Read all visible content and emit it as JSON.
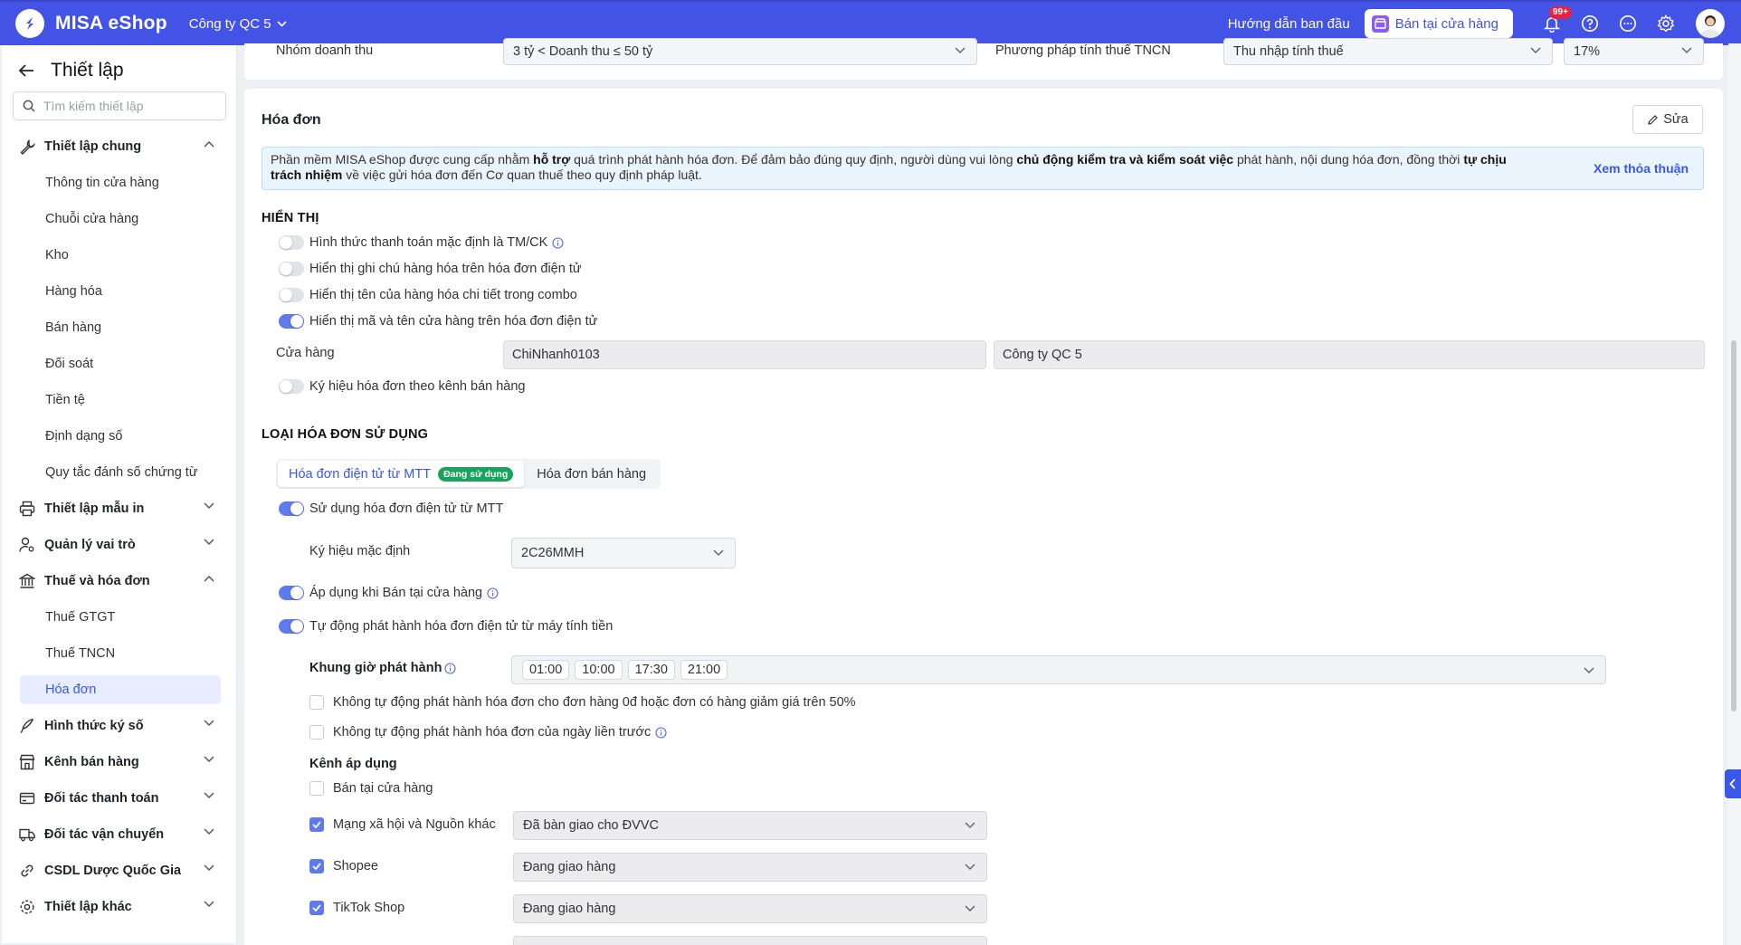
{
  "topbar": {
    "brand": "MISA eShop",
    "company": "Công ty QC 5",
    "guide": "Hướng dẫn ban đầu",
    "store_button": "Bán tại cửa hàng",
    "notification_count": "99+",
    "colors": {
      "bar": "#4353e6",
      "badge": "#e5213d"
    }
  },
  "sidebar": {
    "title": "Thiết lập",
    "search_placeholder": "Tìm kiếm thiết lập",
    "general": "Thiết lập chung",
    "general_items": [
      "Thông tin cửa hàng",
      "Chuỗi cửa hàng",
      "Kho",
      "Hàng hóa",
      "Bán hàng",
      "Đối soát",
      "Tiền tệ",
      "Định dạng số",
      "Quy tắc đánh số chứng từ"
    ],
    "print_template": "Thiết lập mẫu in",
    "roles": "Quản lý vai trò",
    "tax_invoice": "Thuế và hóa đơn",
    "tax_items": [
      "Thuế GTGT",
      "Thuế TNCN",
      "Hóa đơn"
    ],
    "signature": "Hình thức ký số",
    "sales_channels": "Kênh bán hàng",
    "payment_partners": "Đối tác thanh toán",
    "shipping_partners": "Đối tác vận chuyển",
    "pharma_db": "CSDL Dược Quốc Gia",
    "other": "Thiết lập khác"
  },
  "tax_row": {
    "revenue_group_label": "Nhóm doanh thu",
    "revenue_group_value": "3 tỷ < Doanh thu ≤ 50 tỷ",
    "pit_method_label": "Phương pháp tính thuế TNCN",
    "pit_method_value": "Thu nhập tính thuế",
    "rate_value": "17%"
  },
  "invoice": {
    "title": "Hóa đơn",
    "edit": "Sửa",
    "notice_1": "Phần mềm MISA eShop được cung cấp nhằm ",
    "notice_b1": "hỗ trợ",
    "notice_2": " quá trình phát hành hóa đơn. Để đảm bảo đúng quy định, người dùng vui lòng ",
    "notice_b2": "chủ động kiểm tra và kiểm soát việc",
    "notice_3": " phát hành, nội dung hóa đơn, đồng thời ",
    "notice_b3": "tự chịu trách nhiệm",
    "notice_4": " về việc gửi hóa đơn đến Cơ quan thuế theo quy định pháp luật.",
    "notice_link": "Xem thỏa thuận",
    "display_heading": "HIỂN THỊ",
    "opt_payment": "Hình thức thanh toán mặc định là TM/CK",
    "opt_goods_note": "Hiển thị ghi chú hàng hóa trên hóa đơn điện tử",
    "opt_combo": "Hiển thị tên của hàng hóa chi tiết trong combo",
    "opt_store": "Hiển thị mã và tên cửa hàng trên hóa đơn điện tử",
    "store_label": "Cửa hàng",
    "store_code": "ChiNhanh0103",
    "store_name": "Công ty QC 5",
    "opt_channel_symbol": "Ký hiệu hóa đơn theo kênh bán hàng",
    "types_heading": "LOẠI HÓA ĐƠN SỬ DỤNG",
    "tab_mtt": "Hóa đơn điện tử từ MTT",
    "tab_mtt_badge": "Đang sử dụng",
    "tab_sales": "Hóa đơn bán hàng",
    "use_mtt": "Sử dụng hóa đơn điện tử từ MTT",
    "default_symbol_label": "Ký hiệu mặc định",
    "default_symbol_value": "2C26MMH",
    "apply_store": "Áp dụng khi Bán tại cửa hàng",
    "auto_issue": "Tự động phát hành hóa đơn điện tử từ máy tính tiền",
    "time_label": "Khung giờ phát hành",
    "times": [
      "01:00",
      "10:00",
      "17:30",
      "21:00"
    ],
    "no_auto_zero": "Không tự động phát hành hóa đơn cho đơn hàng 0đ hoặc đơn có hàng giảm giá trên 50%",
    "no_auto_prev": "Không tự động phát hành hóa đơn của ngày liền trước",
    "channels_heading": "Kênh áp dụng",
    "channels": [
      {
        "name": "Bán tại cửa hàng",
        "checked": false,
        "status": ""
      },
      {
        "name": "Mạng xã hội và Nguồn khác",
        "checked": true,
        "status": "Đã bàn giao cho ĐVVC"
      },
      {
        "name": "Shopee",
        "checked": true,
        "status": "Đang giao hàng"
      },
      {
        "name": "TikTok Shop",
        "checked": true,
        "status": "Đang giao hàng"
      }
    ]
  }
}
